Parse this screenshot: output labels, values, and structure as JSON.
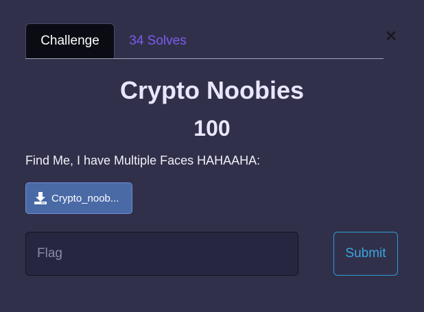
{
  "tabs": {
    "challenge": "Challenge",
    "solves": "34 Solves"
  },
  "close_icon": "close-icon",
  "challenge": {
    "name": "Crypto Noobies",
    "value": "100",
    "description": "Find Me, I have Multiple Faces HAHAAHA:"
  },
  "file": {
    "icon": "download-icon",
    "label": "Crypto_noob..."
  },
  "form": {
    "flag_placeholder": "Flag",
    "submit_label": "Submit"
  },
  "colors": {
    "background": "#31304a",
    "active_tab": "#0b0b14",
    "solves_link": "#7b5cf0",
    "file_button": "#4a6aa6",
    "submit_border": "#2b9fd6"
  }
}
